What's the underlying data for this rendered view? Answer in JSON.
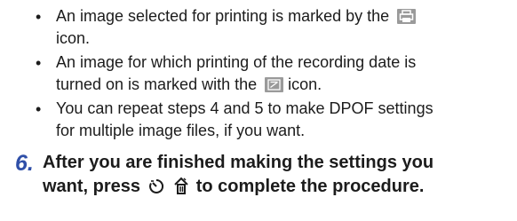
{
  "bullets": [
    {
      "before": "An image selected for printing is marked by the",
      "line2": "icon.",
      "icon": "print-icon"
    },
    {
      "before": "An image for which printing of the recording date is",
      "line2_before": "turned on is marked with the",
      "line2_after": "icon.",
      "icon": "date-icon"
    },
    {
      "line1": "You can repeat steps 4 and 5 to make DPOF settings",
      "line2": "for multiple image files, if you want."
    }
  ],
  "step": {
    "number": "6.",
    "line1": "After you are finished making the settings you",
    "line2_before": "want, press",
    "line2_after": "to complete the procedure.",
    "icons": [
      "self-timer-icon",
      "delete-trash-icon"
    ]
  }
}
